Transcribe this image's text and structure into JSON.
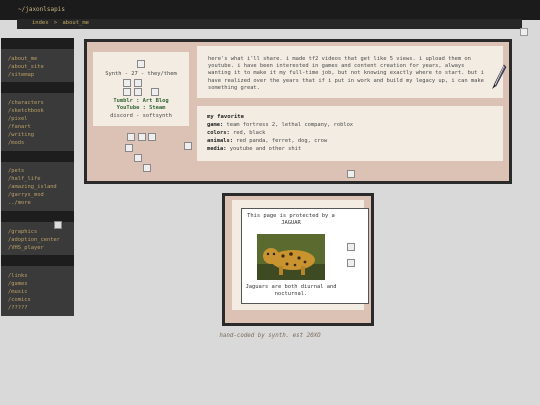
{
  "header": {
    "title": "~/jaxonlsapis",
    "breadcrumb": [
      "index",
      "about_me"
    ],
    "breadcrumb_sep": ">"
  },
  "sidebar": {
    "groups": [
      [
        "/about_me",
        "/about_site",
        "/sitemap"
      ],
      [
        "/characters",
        "/sketchbook",
        "/pixel",
        "/fanart",
        "/writing",
        "/mods"
      ],
      [
        "/pets",
        "/half_life",
        "/amazing_island",
        "/garrys_mod",
        "../more"
      ],
      [
        "/graphics",
        "/adoption_center",
        "/VHS_player"
      ],
      [
        "/links",
        "/games",
        "/music",
        "/comics",
        "/?????"
      ]
    ]
  },
  "profile": {
    "name_line": "Synth - 27 - they/them",
    "tumblr": "Tumblr",
    "art_blog": "Art Blog",
    "youtube": "YouTube",
    "steam": "Steam",
    "sep": ":",
    "discord": "discord - softsynth"
  },
  "intro": {
    "text": "here's what i'll share. i made tf2 videos that get like 5 views. i upload them on youtube. i have been interested in games and content creation for years, always wanting it to make it my full-time job, but not knowing exactly where to start. but i have realized over the years that if i put in work and build my legacy up, i can make something great."
  },
  "favorites": {
    "title": "my favorite",
    "rows": [
      {
        "label": "game:",
        "value": "team fortress 2, lethal company, roblox"
      },
      {
        "label": "colors:",
        "value": "red, black"
      },
      {
        "label": "animals:",
        "value": "red panda, ferret, dog, crow"
      },
      {
        "label": "media:",
        "value": "youtube and other shit"
      }
    ]
  },
  "protected": {
    "text": "This page is protected by a JAGUAR",
    "caption": "Jaguars are both diurnal and nocturnal."
  },
  "footer": {
    "text": "hand-coded by synth. est 20XO"
  },
  "colors": {
    "page_bg": "#d9d9d9",
    "link": "#bba066",
    "panel_bg": "#f2ece3",
    "frame_bg": "#dbc2b4",
    "social": "#336633"
  }
}
